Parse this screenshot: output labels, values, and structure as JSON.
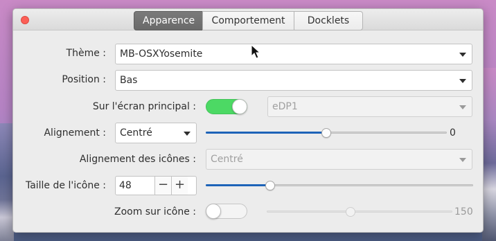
{
  "tabs": [
    "Apparence",
    "Comportement",
    "Docklets"
  ],
  "theme": {
    "label": "Thème :",
    "value": "MB-OSXYosemite"
  },
  "position": {
    "label": "Position :",
    "value": "Bas"
  },
  "primary_screen": {
    "label": "Sur l'écran principal :",
    "toggle_on": true,
    "screen_value": "eDP1"
  },
  "alignment": {
    "label": "Alignement :",
    "value": "Centré",
    "offset_value": "0",
    "slider_fraction": 0.5
  },
  "icon_alignment": {
    "label": "Alignement des icônes :",
    "value": "Centré"
  },
  "icon_size": {
    "label": "Taille de l'icône :",
    "value": "48",
    "minus": "−",
    "plus": "+",
    "slider_fraction": 0.24
  },
  "icon_zoom": {
    "label": "Zoom sur icône :",
    "toggle_on": false,
    "zoom_value": "150",
    "slider_fraction": 0.45
  },
  "colors": {
    "accent": "#1d63b8",
    "toggle_on": "#4cd964",
    "close": "#fc5f57",
    "active_tab": "#6f6f6f"
  }
}
